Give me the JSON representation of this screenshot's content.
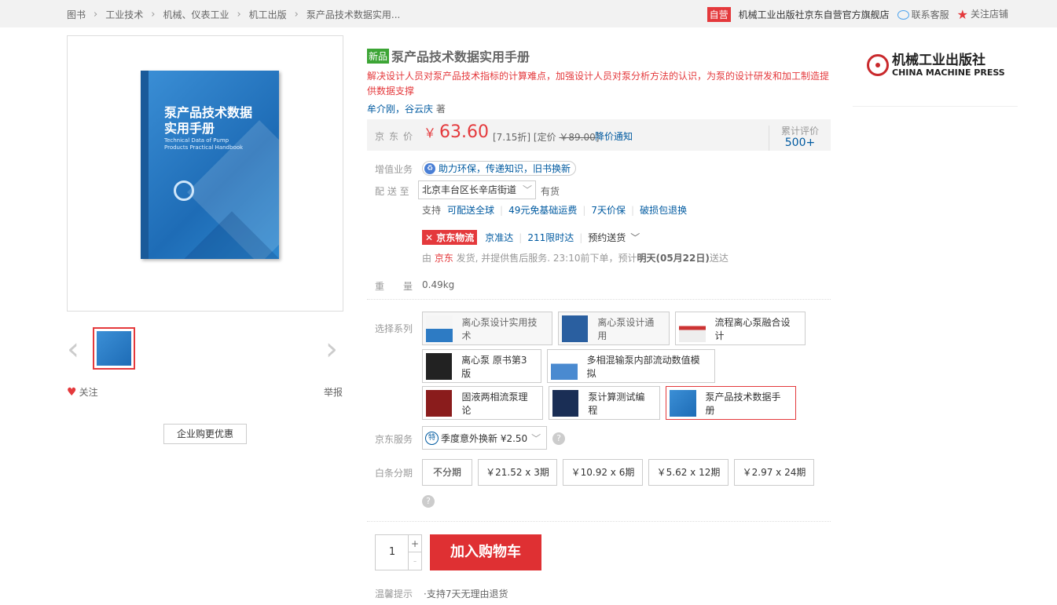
{
  "breadcrumb": [
    "图书",
    "工业技术",
    "机械、仪表工业",
    "机工出版",
    "泵产品技术数据实用..."
  ],
  "shop": {
    "badge": "自营",
    "name": "机械工业出版社京东自营官方旗舰店",
    "contact": "联系客服",
    "follow": "关注店铺"
  },
  "gallery": {
    "follow": "关注",
    "report": "举报",
    "enterprise": "企业购更优惠"
  },
  "cover": {
    "title_line1": "泵产品技术数据",
    "title_line2": "实用手册",
    "en": "Technical Data of Pump Products Practical Handbook"
  },
  "product": {
    "new_badge": "新品",
    "title": "泵产品技术数据实用手册",
    "subtitle": "解决设计人员对泵产品技术指标的计算难点，加强设计人员对泵分析方法的认识，为泵的设计研发和加工制造提供数据支撑",
    "authors": "牟介刚，谷云庆",
    "author_suffix": " 著"
  },
  "price": {
    "label": "京东价",
    "currency": "￥",
    "value": "63.60",
    "discount": "[7.15折] [定价 ",
    "list_price": "￥89.00",
    "discount_end": "]",
    "notify": "降价通知",
    "comments_label": "累计评价",
    "comments": "500+"
  },
  "value_added": {
    "label": "增值业务",
    "text": "助力环保，传递知识，旧书换新"
  },
  "delivery": {
    "label": "配 送 至",
    "address": "北京丰台区长辛店街道",
    "stock": "有货",
    "support_label": "支持",
    "support": [
      "可配送全球",
      "49元免基础运费",
      "7天价保",
      "破损包退换"
    ],
    "logistics_logo": "京东物流",
    "logistics": [
      "京准达",
      "211限时达",
      "预约送货"
    ],
    "ship_prefix": "由 ",
    "ship_seller": "京东",
    "ship_mid": " 发货, 并提供售后服务. 23:10前下单，预计",
    "ship_date": "明天(05月22日)",
    "ship_suffix": "送达"
  },
  "weight": {
    "label": "重　　量",
    "value": "0.49kg"
  },
  "series": {
    "label": "选择系列",
    "items": [
      "离心泵设计实用技术",
      "离心泵设计通用",
      "流程离心泵融合设计",
      "离心泵 原书第3版",
      "多相混输泵内部流动数值模拟",
      "固液两相流泵理论",
      "泵计算测试编程",
      "泵产品技术数据手册"
    ]
  },
  "jd_service": {
    "label": "京东服务",
    "badge": "特",
    "text": "季度意外换新 ¥2.50"
  },
  "installment": {
    "label": "白条分期",
    "options": [
      "不分期",
      "￥21.52 x 3期",
      "￥10.92 x 6期",
      "￥5.62 x 12期",
      "￥2.97 x 24期"
    ]
  },
  "cart": {
    "qty": "1",
    "plus": "+",
    "minus": "-",
    "button": "加入购物车"
  },
  "tips": {
    "label": "温馨提示",
    "text": "·支持7天无理由退货"
  },
  "publisher": {
    "cn": "机械工业出版社",
    "en": "CHINA MACHINE PRESS"
  }
}
